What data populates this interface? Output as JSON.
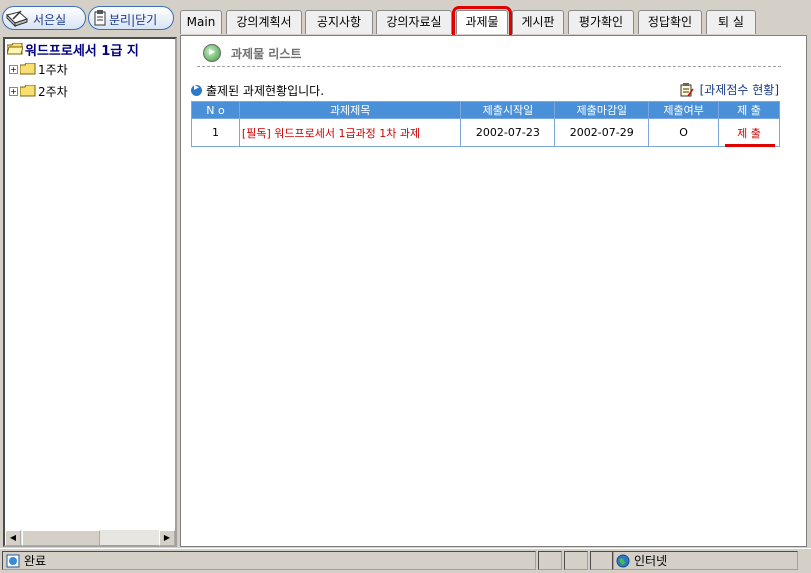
{
  "left_toolbar": {
    "study_room_label": "서은실",
    "separate_label": "분리",
    "close_label": "닫기",
    "separator": "|"
  },
  "tabs": [
    {
      "label": "Main",
      "active": false
    },
    {
      "label": "강의계획서",
      "active": false
    },
    {
      "label": "공지사항",
      "active": false
    },
    {
      "label": "강의자료실",
      "active": false
    },
    {
      "label": "과제물",
      "active": true
    },
    {
      "label": "게시판",
      "active": false
    },
    {
      "label": "평가확인",
      "active": false
    },
    {
      "label": "정답확인",
      "active": false
    },
    {
      "label": "퇴 실",
      "active": false
    }
  ],
  "tree": {
    "root_label": "워드프로세서 1급 지",
    "items": [
      {
        "label": "1주차"
      },
      {
        "label": "2주차"
      }
    ]
  },
  "main": {
    "section_title": "과제물 리스트",
    "status_text": "출제된 과제현황입니다.",
    "score_link": "[과제점수 현황]",
    "table": {
      "headers": [
        "N o",
        "과제제목",
        "제출시작일",
        "제출마감일",
        "제출여부",
        "제 출"
      ],
      "rows": [
        {
          "no": "1",
          "title": "[필독] 워드프로세서 1급과정 1차 과제",
          "start": "2002-07-23",
          "end": "2002-07-29",
          "submitted": "O",
          "action": "제 출"
        }
      ]
    }
  },
  "statusbar": {
    "status": "완료",
    "zone": "인터넷"
  },
  "colors": {
    "accent_red": "#e00000",
    "table_header": "#4a90d8",
    "link_blue": "#1a3a8a"
  }
}
